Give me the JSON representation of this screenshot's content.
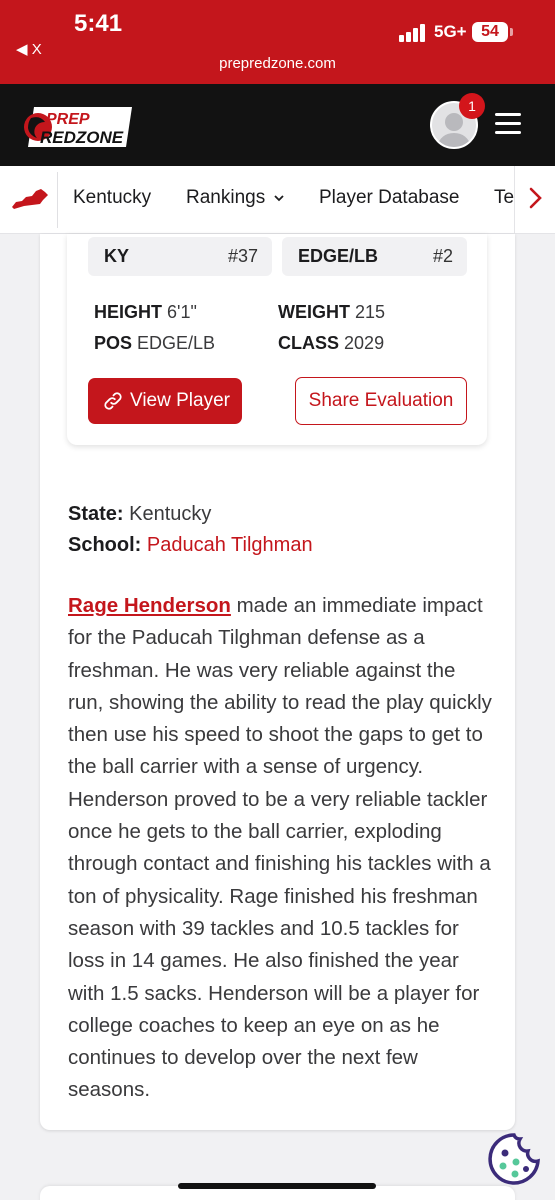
{
  "status_bar": {
    "time": "5:41",
    "back_label": "◀ X",
    "url": "prepredzone.com",
    "network": "5G+",
    "battery": "54"
  },
  "header": {
    "logo_line1": "PREP",
    "logo_line2": "REDZONE",
    "notification_count": "1"
  },
  "nav": {
    "items": [
      "Kentucky",
      "Rankings",
      "Player Database",
      "Te"
    ]
  },
  "player_card": {
    "state_chip": {
      "label": "KY",
      "rank": "#37"
    },
    "position_chip": {
      "label": "EDGE/LB",
      "rank": "#2"
    },
    "stats": [
      {
        "label": "HEIGHT",
        "value": "6'1\""
      },
      {
        "label": "WEIGHT",
        "value": "215"
      },
      {
        "label": "POS",
        "value": "EDGE/LB"
      },
      {
        "label": "CLASS",
        "value": "2029"
      }
    ],
    "view_button": "View Player",
    "share_button": "Share Evaluation"
  },
  "info": {
    "state_label": "State:",
    "state_value": "Kentucky",
    "school_label": "School:",
    "school_value": "Paducah Tilghman"
  },
  "article": {
    "player_link": "Rage Henderson",
    "body": " made an immediate impact for the Paducah Tilghman defense as a freshman. He was very reliable against the run, showing the ability to read the play quickly then use his speed to shoot the gaps to get to the ball carrier with a sense of urgency. Henderson proved to be a very reliable tackler once he gets to the ball carrier, exploding through contact and finishing his tackles with a ton of physicality. Rage finished his freshman season with 39 tackles and 10.5 tackles for loss in 14 games. He also finished the year with 1.5 sacks. Henderson will be a player for college coaches to keep an eye on as he continues to develop over the next few seasons."
  },
  "colors": {
    "brand_red": "#c4161c",
    "header_bg": "#121212"
  },
  "icons": [
    "signal-icon",
    "battery-icon",
    "avatar-icon",
    "menu-icon",
    "kentucky-state-icon",
    "chevron-down-icon",
    "chevron-right-icon",
    "link-icon",
    "cookie-icon"
  ]
}
